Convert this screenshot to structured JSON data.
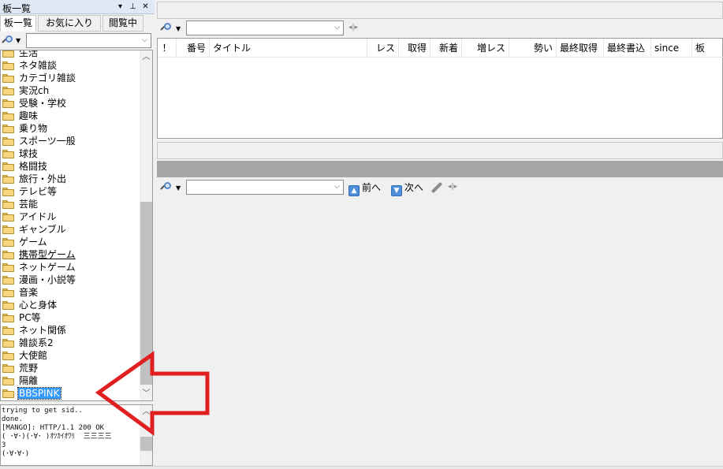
{
  "left_pane": {
    "title": "板一覧",
    "pin_glyph": "▾",
    "pin2_glyph": "⊥",
    "close_glyph": "✕",
    "tabs": [
      "板一覧",
      "お気に入り",
      "閲覧中"
    ],
    "search_placeholder": "",
    "tree_items": [
      {
        "label": "生活"
      },
      {
        "label": "ネタ雑談"
      },
      {
        "label": "カテゴリ雑談"
      },
      {
        "label": "実況ch"
      },
      {
        "label": "受験・学校"
      },
      {
        "label": "趣味"
      },
      {
        "label": "乗り物"
      },
      {
        "label": "スポーツ一般"
      },
      {
        "label": "球技"
      },
      {
        "label": "格闘技"
      },
      {
        "label": "旅行・外出"
      },
      {
        "label": "テレビ等"
      },
      {
        "label": "芸能"
      },
      {
        "label": "アイドル"
      },
      {
        "label": "ギャンブル"
      },
      {
        "label": "ゲーム"
      },
      {
        "label": "携帯型ゲーム",
        "hover": true
      },
      {
        "label": "ネットゲーム"
      },
      {
        "label": "漫画・小説等"
      },
      {
        "label": "音楽"
      },
      {
        "label": "心と身体"
      },
      {
        "label": "PC等"
      },
      {
        "label": "ネット関係"
      },
      {
        "label": "雑談系2"
      },
      {
        "label": "大使館"
      },
      {
        "label": "荒野"
      },
      {
        "label": "隔離"
      },
      {
        "label": "BBSPINK",
        "selected": true
      }
    ],
    "log_text": "trying to get sid..\ndone.\n[MANGO]: HTTP/1.1 200 OK\n( ･∀･)(･∀･ )ｵﾂｶｲｵﾜﾘ  三三三三\n3\n(･∀･∀･)"
  },
  "thread_list": {
    "search_placeholder": "",
    "columns": [
      "！",
      "番号",
      "タイトル",
      "レス",
      "取得",
      "新着",
      "増レス",
      "勢い",
      "最終取得",
      "最終書込",
      "since",
      "板"
    ]
  },
  "post_view": {
    "search_placeholder": "",
    "prev_label": "前へ",
    "next_label": "次へ"
  },
  "colors": {
    "selection": "#3399ff",
    "annotation_arrow": "#e02020",
    "folder": "#f3d67e"
  },
  "icons": [
    "magnifier-icon",
    "folder-icon",
    "pin-icon",
    "close-icon",
    "chevron-down-icon",
    "up-arrow-icon",
    "down-arrow-icon",
    "pen-icon"
  ]
}
